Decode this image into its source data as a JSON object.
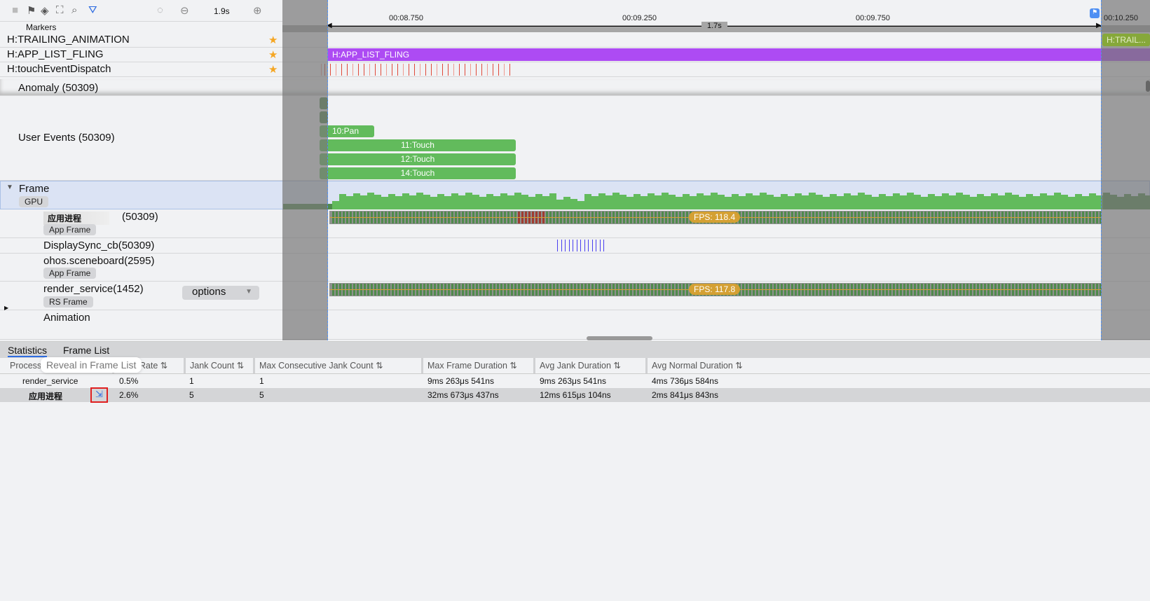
{
  "toolbar": {
    "icons": [
      "stop-icon",
      "flag-icon",
      "compass-icon",
      "capture-icon",
      "search-icon",
      "filter-icon",
      "reset-icon",
      "zoom-out-icon",
      "zoom-in-icon"
    ],
    "scale": "1.9s"
  },
  "markers_label": "Markers",
  "ruler": {
    "ticks": [
      "00:08.750",
      "00:09.250",
      "00:09.750",
      "00:10.250"
    ],
    "range_label": "1.7s"
  },
  "marker_rows": [
    {
      "label": "H:TRAILING_ANIMATION",
      "slice": "H:TRAIL..."
    },
    {
      "label": "H:APP_LIST_FLING",
      "slice": "H:APP_LIST_FLING"
    },
    {
      "label": "H:touchEventDispatch"
    }
  ],
  "tracks": {
    "anomaly": "Anomaly (50309)",
    "user_events": {
      "label": "User Events (50309)",
      "events": [
        "10:Pan",
        "11:Touch",
        "12:Touch",
        "14:Touch"
      ]
    },
    "frame": {
      "label": "Frame",
      "tag": "GPU"
    },
    "app_process": {
      "name": "应用进程",
      "pid": "(50309)",
      "tag": "App Frame",
      "fps": "FPS: 118.4"
    },
    "display_sync": "DisplaySync_cb(50309)",
    "sceneboard": {
      "label": "ohos.sceneboard(2595)",
      "tag": "App Frame"
    },
    "render_service": {
      "label": "render_service(1452)",
      "tag": "RS Frame",
      "fps": "FPS: 117.8",
      "options": "options"
    },
    "animation": "Animation"
  },
  "bottom": {
    "tabs": [
      "Statistics",
      "Frame List"
    ],
    "active_tab": "Statistics",
    "tooltip": "Reveal in Frame List",
    "columns": [
      "Process",
      "Jank Rate",
      "Jank Count",
      "Max Consecutive Jank Count",
      "Max Frame Duration",
      "Avg Jank Duration",
      "Avg Normal Duration"
    ],
    "sort_icon": "⇅",
    "rows": [
      [
        "render_service",
        "0.5%",
        "1",
        "1",
        "9ms 263μs 541ns",
        "9ms 263μs 541ns",
        "4ms 736μs 584ns"
      ],
      [
        "应用进程",
        "2.6%",
        "5",
        "5",
        "32ms 673μs 437ns",
        "12ms 615μs 104ns",
        "2ms 841μs 843ns"
      ]
    ]
  },
  "colors": {
    "fling": "#ad4bf3",
    "event": "#62bb5c",
    "fps": "#d4a033",
    "accent": "#2f6de1",
    "touch": "#e0493a"
  }
}
